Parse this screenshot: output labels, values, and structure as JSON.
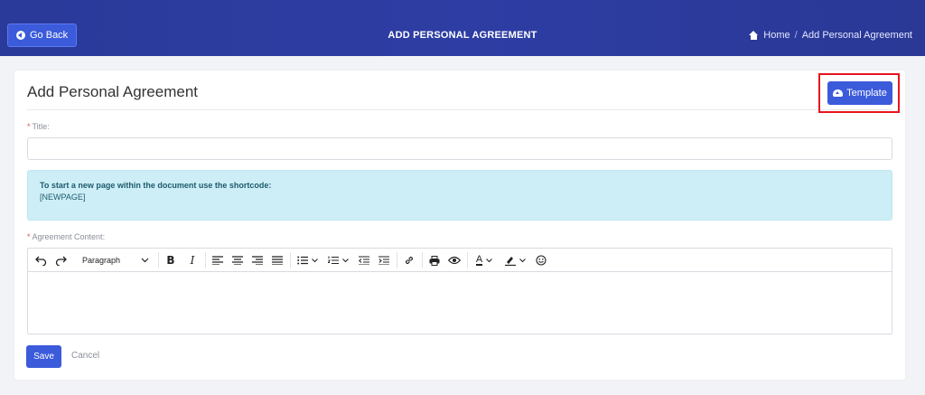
{
  "header": {
    "back_label": "Go Back",
    "page_heading": "ADD PERSONAL AGREEMENT",
    "breadcrumb": {
      "home": "Home",
      "separator": "/",
      "current": "Add Personal Agreement"
    },
    "colors": {
      "bar": "#2d3da3",
      "primary": "#3b5bdb"
    }
  },
  "card": {
    "title": "Add Personal Agreement",
    "template_label": "Template",
    "highlight_color": "#e8141c"
  },
  "form": {
    "required_mark": "*",
    "title_label": "Title:",
    "title_value": "",
    "info_line1": "To start a new page within the document use the shortcode:",
    "info_line2": "[NEWPAGE]",
    "content_label": "Agreement Content:",
    "editor": {
      "block_format": "Paragraph",
      "tools": [
        "undo-icon",
        "redo-icon",
        "bold-icon",
        "italic-icon",
        "align-left-icon",
        "align-center-icon",
        "align-right-icon",
        "align-justify-icon",
        "bullet-list-icon",
        "numbered-list-icon",
        "outdent-icon",
        "indent-icon",
        "link-icon",
        "print-icon",
        "preview-icon",
        "text-color-icon",
        "highlight-icon",
        "emoji-icon"
      ],
      "bold_glyph": "B",
      "italic_glyph": "I",
      "text_color_glyph": "A",
      "content": ""
    },
    "save_label": "Save",
    "cancel_label": "Cancel"
  }
}
